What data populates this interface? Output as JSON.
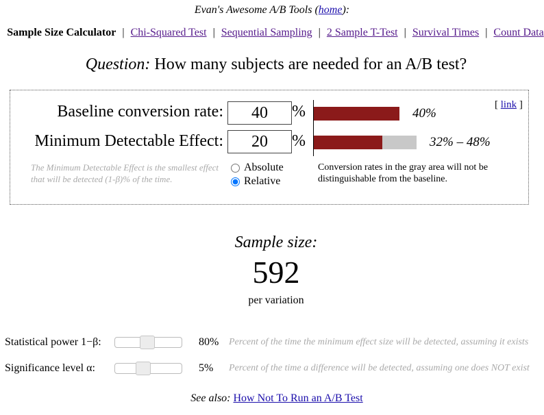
{
  "header": {
    "site_title_prefix": "Evan's Awesome A/B Tools (",
    "home_link": "home",
    "site_title_suffix": "):"
  },
  "nav": {
    "current": "Sample Size Calculator",
    "links": [
      "Chi-Squared Test",
      "Sequential Sampling",
      "2 Sample T-Test",
      "Survival Times",
      "Count Data"
    ],
    "separator": "|"
  },
  "question": {
    "prefix": "Question:",
    "text": "How many subjects are needed for an A/B test?"
  },
  "calculator": {
    "link_text": "link",
    "baseline": {
      "label": "Baseline conversion rate:",
      "value": "40",
      "unit": "%",
      "bar_text": "40%",
      "bar_fraction": 0.4
    },
    "mde": {
      "label": "Minimum Detectable Effect:",
      "value": "20",
      "unit": "%",
      "bar_text": "32% – 48%",
      "range_low_fraction": 0.32,
      "range_high_fraction": 0.48
    },
    "mde_help": "The Minimum Detectable Effect is the smallest effect that will be detected (1-β)% of the time.",
    "mode_options": [
      {
        "label": "Absolute",
        "checked": false
      },
      {
        "label": "Relative",
        "checked": true
      }
    ],
    "gray_note": "Conversion rates in the gray area will not be distinguishable from the baseline."
  },
  "result": {
    "label": "Sample size:",
    "value": "592",
    "unit": "per variation"
  },
  "sliders": {
    "power": {
      "label": "Statistical power 1−β:",
      "value": "80%",
      "level": 0.8,
      "help": "Percent of the time the minimum effect size will be detected, assuming it exists"
    },
    "significance": {
      "label": "Significance level α:",
      "value": "5%",
      "level": 0.05,
      "help": "Percent of the time a difference will be detected, assuming one does NOT exist"
    }
  },
  "footer": {
    "prefix": "See also:",
    "link": "How Not To Run an A/B Test"
  },
  "colors": {
    "bar_red": "#8b1a1a",
    "bar_gray": "#c8c8c8",
    "help_text": "#aaaaaa",
    "link": "#1a0dab",
    "visited_link": "#551a8b"
  }
}
